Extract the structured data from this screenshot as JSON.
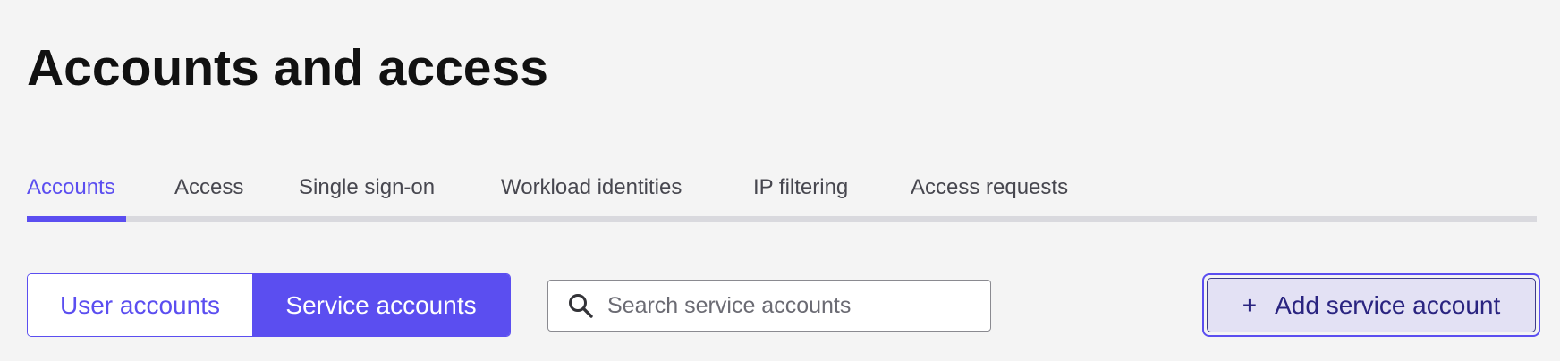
{
  "page": {
    "title": "Accounts and access"
  },
  "tabs": [
    {
      "label": "Accounts",
      "active": true
    },
    {
      "label": "Access",
      "active": false
    },
    {
      "label": "Single sign-on",
      "active": false
    },
    {
      "label": "Workload identities",
      "active": false
    },
    {
      "label": "IP filtering",
      "active": false
    },
    {
      "label": "Access requests",
      "active": false
    }
  ],
  "account_type_toggle": {
    "options": [
      {
        "label": "User accounts",
        "selected": false
      },
      {
        "label": "Service accounts",
        "selected": true
      }
    ]
  },
  "search": {
    "icon": "search-icon",
    "value": "",
    "placeholder": "Search service accounts"
  },
  "actions": {
    "add_icon": "+",
    "add_label": "Add service account"
  },
  "colors": {
    "accent": "#5b4ef0",
    "background": "#f4f4f4",
    "button_tint": "#e3e1f4",
    "button_text": "#2a2480"
  }
}
